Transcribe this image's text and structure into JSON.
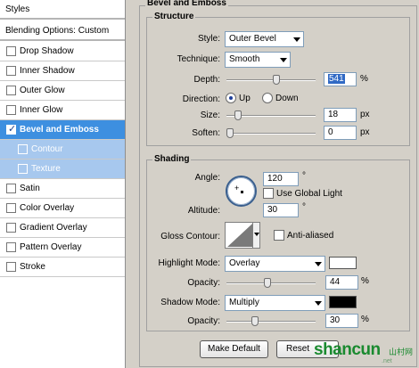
{
  "styles_panel": {
    "header": "Styles",
    "blending": "Blending Options: Custom",
    "items": [
      {
        "label": "Drop Shadow",
        "checked": false
      },
      {
        "label": "Inner Shadow",
        "checked": false
      },
      {
        "label": "Outer Glow",
        "checked": false
      },
      {
        "label": "Inner Glow",
        "checked": false
      },
      {
        "label": "Bevel and Emboss",
        "checked": true,
        "selected": true
      },
      {
        "label": "Contour",
        "checked": false,
        "sub": true
      },
      {
        "label": "Texture",
        "checked": false,
        "sub": true
      },
      {
        "label": "Satin",
        "checked": false
      },
      {
        "label": "Color Overlay",
        "checked": false
      },
      {
        "label": "Gradient Overlay",
        "checked": false
      },
      {
        "label": "Pattern Overlay",
        "checked": false
      },
      {
        "label": "Stroke",
        "checked": false
      }
    ]
  },
  "bevel": {
    "title": "Bevel and Emboss",
    "structure": {
      "title": "Structure",
      "style_label": "Style:",
      "style_value": "Outer Bevel",
      "technique_label": "Technique:",
      "technique_value": "Smooth",
      "depth_label": "Depth:",
      "depth_value": "541",
      "depth_unit": "%",
      "direction_label": "Direction:",
      "direction_up": "Up",
      "direction_down": "Down",
      "size_label": "Size:",
      "size_value": "18",
      "size_unit": "px",
      "soften_label": "Soften:",
      "soften_value": "0",
      "soften_unit": "px"
    },
    "shading": {
      "title": "Shading",
      "angle_label": "Angle:",
      "angle_value": "120",
      "angle_unit": "°",
      "global_light_label": "Use Global Light",
      "altitude_label": "Altitude:",
      "altitude_value": "30",
      "altitude_unit": "°",
      "gloss_label": "Gloss Contour:",
      "anti_aliased_label": "Anti-aliased",
      "highlight_mode_label": "Highlight Mode:",
      "highlight_mode_value": "Overlay",
      "highlight_color": "#ffffff",
      "highlight_opacity_label": "Opacity:",
      "highlight_opacity_value": "44",
      "highlight_opacity_unit": "%",
      "shadow_mode_label": "Shadow Mode:",
      "shadow_mode_value": "Multiply",
      "shadow_color": "#000000",
      "shadow_opacity_label": "Opacity:",
      "shadow_opacity_value": "30",
      "shadow_opacity_unit": "%"
    },
    "make_default": "Make Default",
    "reset_default": "Reset"
  },
  "watermark": {
    "brand": "shancun",
    "cn": "山村网",
    "site": ".net"
  }
}
